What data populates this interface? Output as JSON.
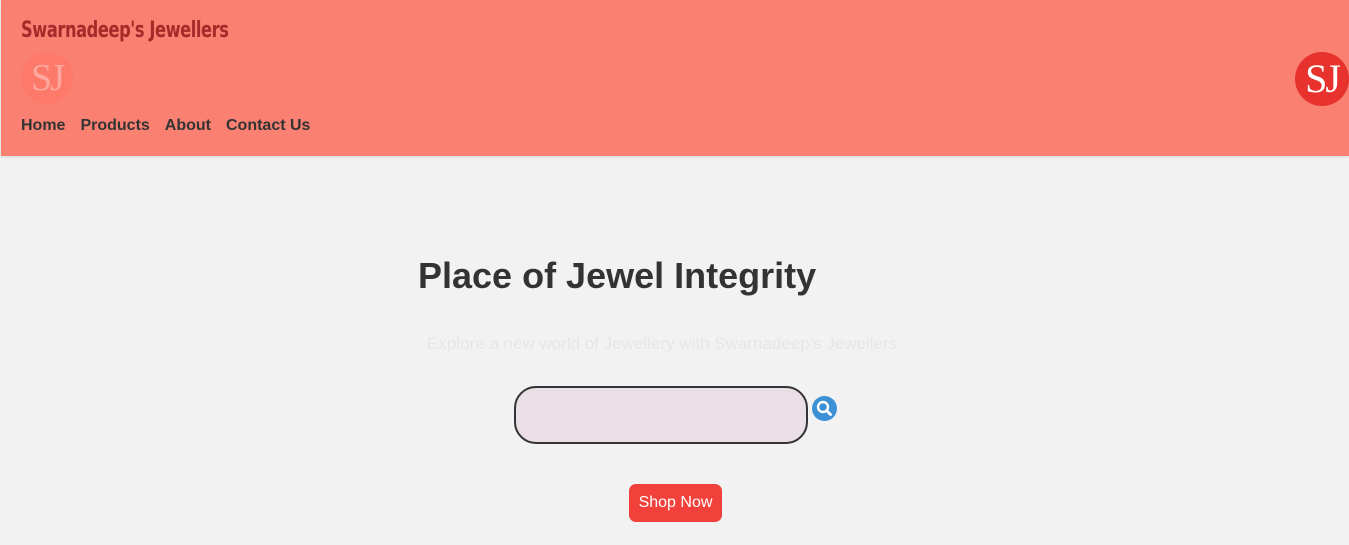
{
  "header": {
    "brand": "Swarnadeep's Jewellers",
    "logo_text": "SJ",
    "nav": [
      {
        "label": "Home"
      },
      {
        "label": "Products"
      },
      {
        "label": "About"
      },
      {
        "label": "Contact Us"
      }
    ]
  },
  "hero": {
    "title": "Place of Jewel Integrity",
    "subtitle": "Explore a new world of Jewellery with Swarnadeep's Jewellers",
    "search": {
      "value": "",
      "placeholder": ""
    },
    "shop_label": "Shop Now"
  },
  "colors": {
    "header_bg": "#fa8072",
    "brand_text": "#a52a2a",
    "logo_bg": "#e8322e",
    "page_bg": "#f2f2f2",
    "search_bg": "#ebdfe7",
    "search_icon_bg": "#3d8fd6",
    "button_bg": "#f2413a"
  },
  "icons": {
    "search": "magnifier-icon",
    "logo": "sj-monogram"
  }
}
